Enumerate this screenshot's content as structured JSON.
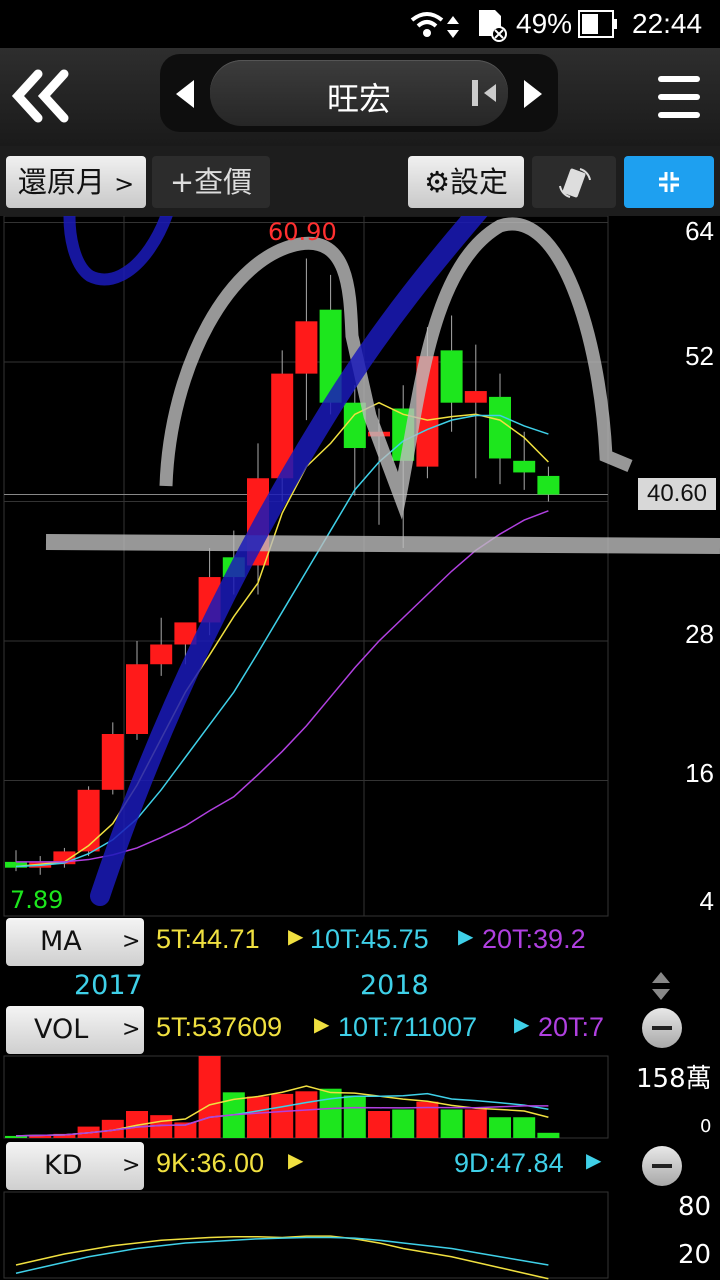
{
  "status": {
    "battery": "49%",
    "time": "22:44"
  },
  "nav": {
    "title": "旺宏"
  },
  "toolbar": {
    "restore": "還原月",
    "chevron": ">",
    "quote": "+查價",
    "settings": "⚙設定"
  },
  "price_axis": {
    "ticks": [
      "64",
      "52",
      "40.60",
      "28",
      "16",
      "4"
    ],
    "high_label": "60.90",
    "low_label": "7.89"
  },
  "ma": {
    "button": "MA",
    "t5": "5T:44.71",
    "t10": "10T:45.75",
    "t20": "20T:39.2"
  },
  "years": {
    "y2017": "2017",
    "y2018": "2018"
  },
  "vol": {
    "button": "VOL",
    "t5": "5T:537609",
    "t10": "10T:711007",
    "t20": "20T:7",
    "max": "158萬",
    "zero": "0"
  },
  "kd": {
    "button": "KD",
    "k": "9K:36.00",
    "d": "9D:47.84",
    "t80": "80",
    "t20": "20"
  },
  "colors": {
    "up": "#ff1a1a",
    "down": "#1de61d",
    "ma5": "#f0e040",
    "ma10": "#3fd0e8",
    "ma20": "#b040e0",
    "accent": "#1ea0f0"
  },
  "chart_data": {
    "type": "candlestick",
    "candles": [
      {
        "o": 9.0,
        "h": 10.0,
        "l": 8.2,
        "c": 8.5
      },
      {
        "o": 8.5,
        "h": 9.5,
        "l": 7.89,
        "c": 9.0
      },
      {
        "o": 8.8,
        "h": 10.2,
        "l": 8.5,
        "c": 9.9
      },
      {
        "o": 9.9,
        "h": 15.5,
        "l": 9.5,
        "c": 15.2
      },
      {
        "o": 15.2,
        "h": 21.0,
        "l": 14.8,
        "c": 20.0
      },
      {
        "o": 20.0,
        "h": 28.0,
        "l": 19.5,
        "c": 26.0
      },
      {
        "o": 26.0,
        "h": 30.0,
        "l": 25.0,
        "c": 27.7
      },
      {
        "o": 27.7,
        "h": 29.5,
        "l": 26.0,
        "c": 29.6
      },
      {
        "o": 29.6,
        "h": 36.0,
        "l": 28.5,
        "c": 33.5
      },
      {
        "o": 35.2,
        "h": 37.5,
        "l": 32.0,
        "c": 33.5
      },
      {
        "o": 34.5,
        "h": 45.0,
        "l": 32.0,
        "c": 42.0
      },
      {
        "o": 42.0,
        "h": 53.0,
        "l": 40.0,
        "c": 51.0
      },
      {
        "o": 51.0,
        "h": 60.9,
        "l": 47.0,
        "c": 55.5
      },
      {
        "o": 56.5,
        "h": 59.5,
        "l": 47.5,
        "c": 48.5
      },
      {
        "o": 48.5,
        "h": 50.0,
        "l": 40.5,
        "c": 44.6
      },
      {
        "o": 45.6,
        "h": 48.0,
        "l": 38.0,
        "c": 46.0
      },
      {
        "o": 48.0,
        "h": 50.0,
        "l": 36.0,
        "c": 43.5
      },
      {
        "o": 43.0,
        "h": 55.0,
        "l": 42.0,
        "c": 52.5
      },
      {
        "o": 53.0,
        "h": 56.0,
        "l": 46.0,
        "c": 48.5
      },
      {
        "o": 48.5,
        "h": 53.5,
        "l": 42.0,
        "c": 49.5
      },
      {
        "o": 49.0,
        "h": 51.0,
        "l": 41.5,
        "c": 43.7
      },
      {
        "o": 43.5,
        "h": 46.0,
        "l": 41.0,
        "c": 42.5
      },
      {
        "o": 42.2,
        "h": 43.0,
        "l": 40.0,
        "c": 40.6
      }
    ],
    "ma5": [
      8.6,
      8.8,
      9.0,
      10.4,
      12.3,
      15.6,
      19.6,
      23.6,
      26.8,
      30.1,
      33.0,
      39.0,
      43.0,
      45.0,
      47.5,
      48.5,
      47.5,
      47.0,
      47.3,
      47.5,
      47.0,
      45.5,
      43.4
    ],
    "ma10": [
      8.6,
      8.7,
      8.9,
      9.7,
      10.9,
      12.7,
      15.2,
      18.0,
      20.8,
      23.6,
      27.0,
      30.5,
      34.0,
      37.5,
      41.0,
      43.4,
      45.2,
      46.2,
      47.0,
      47.4,
      47.4,
      46.5,
      45.8
    ],
    "ma20": [
      9.0,
      9.0,
      9.0,
      9.2,
      9.6,
      10.2,
      11.1,
      12.1,
      13.4,
      14.6,
      16.5,
      18.5,
      20.7,
      23.2,
      25.7,
      28.0,
      30.0,
      32.0,
      34.0,
      35.8,
      37.2,
      38.4,
      39.2
    ],
    "price_range": [
      4,
      66
    ],
    "volume": [
      4,
      6,
      8,
      22,
      35,
      52,
      44,
      30,
      158,
      88,
      80,
      85,
      90,
      95,
      82,
      52,
      55,
      70,
      55,
      55,
      40,
      40,
      10
    ],
    "k": [
      24,
      28,
      32,
      35,
      38,
      40,
      42,
      43,
      44,
      44.5,
      44.5,
      44,
      45,
      45,
      43,
      40,
      36,
      33,
      30,
      26,
      22,
      18,
      14
    ],
    "d": [
      18,
      22,
      26,
      30,
      33,
      36,
      38,
      40,
      41,
      42,
      43,
      43.5,
      44,
      44,
      43.5,
      42,
      40,
      38,
      36,
      33,
      30,
      27,
      24
    ]
  }
}
